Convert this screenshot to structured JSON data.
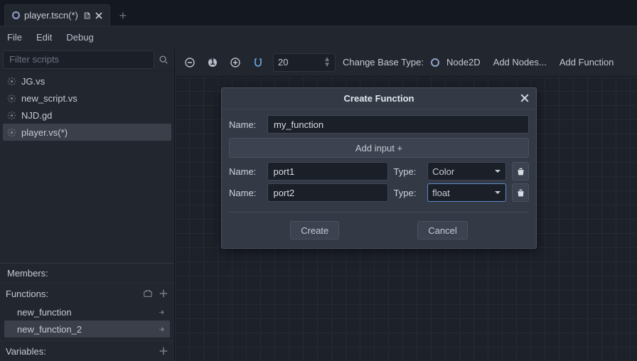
{
  "tab": {
    "title": "player.tscn(*)"
  },
  "menu": {
    "file": "File",
    "edit": "Edit",
    "debug": "Debug"
  },
  "filter": {
    "placeholder": "Filter scripts"
  },
  "scripts": [
    {
      "name": "JG.vs"
    },
    {
      "name": "new_script.vs"
    },
    {
      "name": "NJD.gd"
    },
    {
      "name": "player.vs(*)",
      "selected": true
    }
  ],
  "members_label": "Members:",
  "functions_label": "Functions:",
  "variables_label": "Variables:",
  "functions": [
    {
      "name": "new_function"
    },
    {
      "name": "new_function_2",
      "selected": true
    }
  ],
  "toolbar": {
    "zoom": "20",
    "change_base": "Change Base Type:",
    "base_type": "Node2D",
    "add_nodes": "Add Nodes...",
    "add_function": "Add Function"
  },
  "dialog": {
    "title": "Create Function",
    "name_label": "Name:",
    "fn_name": "my_function",
    "add_input": "Add input +",
    "type_label": "Type:",
    "inputs": [
      {
        "name": "port1",
        "type": "Color"
      },
      {
        "name": "port2",
        "type": "float",
        "focused": true
      }
    ],
    "create": "Create",
    "cancel": "Cancel"
  }
}
